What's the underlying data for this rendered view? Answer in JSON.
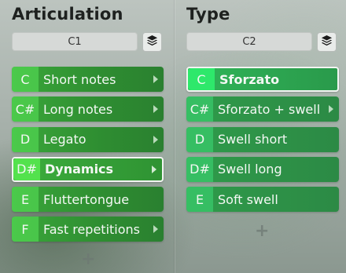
{
  "articulation": {
    "title": "Articulation",
    "slot": "C1",
    "items": [
      {
        "note": "C",
        "label": "Short notes",
        "has_submenu": true,
        "selected": false
      },
      {
        "note": "C#",
        "label": "Long notes",
        "has_submenu": true,
        "selected": false
      },
      {
        "note": "D",
        "label": "Legato",
        "has_submenu": true,
        "selected": false
      },
      {
        "note": "D#",
        "label": "Dynamics",
        "has_submenu": true,
        "selected": true
      },
      {
        "note": "E",
        "label": "Fluttertongue",
        "has_submenu": false,
        "selected": false
      },
      {
        "note": "F",
        "label": "Fast repetitions",
        "has_submenu": true,
        "selected": false
      }
    ],
    "add_label": "+"
  },
  "type": {
    "title": "Type",
    "slot": "C2",
    "items": [
      {
        "note": "C",
        "label": "Sforzato",
        "has_submenu": false,
        "selected": true
      },
      {
        "note": "C#",
        "label": "Sforzato + swell",
        "has_submenu": true,
        "selected": false
      },
      {
        "note": "D",
        "label": "Swell short",
        "has_submenu": false,
        "selected": false
      },
      {
        "note": "D#",
        "label": "Swell long",
        "has_submenu": false,
        "selected": false
      },
      {
        "note": "E",
        "label": "Soft swell",
        "has_submenu": false,
        "selected": false
      }
    ],
    "add_label": "+"
  },
  "icons": {
    "layers": "layers-icon",
    "chevron": "chevron-right-icon"
  }
}
